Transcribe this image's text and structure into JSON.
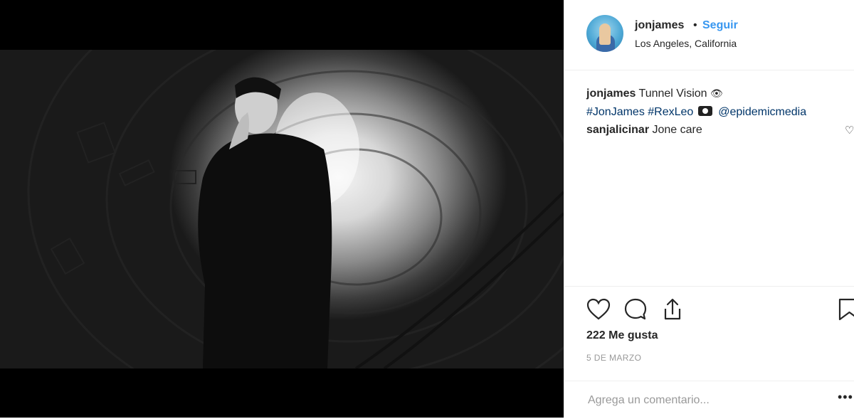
{
  "post": {
    "image_alt": "Man in black jacket making a shush gesture in a concrete tunnel",
    "author": {
      "username": "jonjames",
      "separator": "•",
      "follow_label": "Seguir",
      "location": "Los Angeles, California"
    },
    "caption": {
      "username": "jonjames",
      "text": "Tunnel Vision",
      "eye_emoji": "👁",
      "hashtag1": "#JonJames",
      "hashtag2": "#RexLeo",
      "mention": "@epidemicmedia"
    },
    "comments": [
      {
        "username": "sanjalicinar",
        "text": "Jone care"
      }
    ],
    "likes_text": "222 Me gusta",
    "date": "5 DE MARZO",
    "comment_placeholder": "Agrega un comentario...",
    "more_label": "•••"
  },
  "colors": {
    "link_blue": "#3897f0",
    "hashtag": "#003569",
    "muted": "#999999",
    "divider": "#efefef"
  },
  "icons": [
    "heart-icon",
    "comment-icon",
    "share-icon",
    "bookmark-icon",
    "camera-icon"
  ]
}
